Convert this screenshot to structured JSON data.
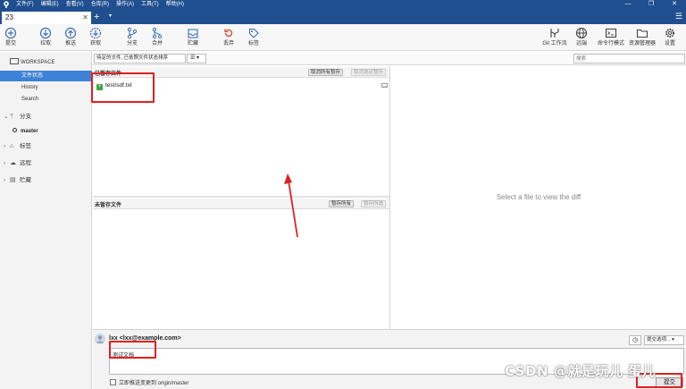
{
  "menu": [
    "文件(F)",
    "编辑(E)",
    "查看(V)",
    "仓库(R)",
    "操作(A)",
    "工具(T)",
    "帮助(H)"
  ],
  "window_controls": [
    "—",
    "❐",
    "✕"
  ],
  "tab": {
    "label": "23",
    "close": "✕"
  },
  "tab_new": "+",
  "tab_dropdown": "▾",
  "menu_icon": "☰",
  "toolbar": {
    "commit": "提交",
    "pull": "拉取",
    "push": "推送",
    "fetch": "获取",
    "branch": "分支",
    "merge": "合并",
    "stash": "贮藏",
    "discard": "丢弃",
    "tag": "标签",
    "git_flow": "Git 工作流",
    "remote": "远端",
    "terminal": "命令行模式",
    "explorer": "资源管理器",
    "settings": "设置"
  },
  "sidebar": {
    "workspace": "WORKSPACE",
    "items": [
      "文件状态",
      "History",
      "Search"
    ],
    "branches": "分支",
    "current_branch": "master",
    "tags": "标签",
    "remotes": "远程",
    "stashes": "贮藏"
  },
  "filter": {
    "sort_label": "待定的文件, 已依照文件状态排序",
    "view_label": "☰ ▾",
    "search_placeholder": "搜索"
  },
  "staged": {
    "title": "已暂存文件",
    "unstage_all": "取消所有暂存",
    "unstage_selected": "取消选定暂存",
    "files": [
      {
        "name": "test/sdf.txt",
        "status": "+"
      }
    ],
    "file_menu": "—"
  },
  "unstaged": {
    "title": "未暂存文件",
    "stage_all": "暂存所有",
    "stage_selected": "暂存所选"
  },
  "diff": {
    "placeholder": "Select a file to view the diff"
  },
  "commit": {
    "author": "lxx <lxx@example.com>",
    "message": "测试文档",
    "options": "提交选项... ▾",
    "push_now": "立即推送变更到 origin/master",
    "commit_button": "提交"
  },
  "watermark": "CSDN @就是玩儿 蛋儿",
  "colors": {
    "titlebar": "#1f4f8f",
    "selected": "#3d82d6",
    "annotation": "#e02020"
  }
}
